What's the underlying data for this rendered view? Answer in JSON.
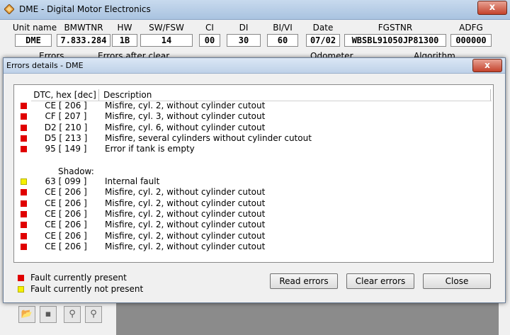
{
  "window": {
    "title": "DME - Digital Motor Electronics",
    "close_label": "x"
  },
  "info": [
    {
      "key": "unit",
      "label": "Unit name",
      "value": "DME"
    },
    {
      "key": "bmwtnr",
      "label": "BMWTNR",
      "value": "7.833.284"
    },
    {
      "key": "hw",
      "label": "HW",
      "value": "1B"
    },
    {
      "key": "swfsw",
      "label": "SW/FSW",
      "value": "14"
    },
    {
      "key": "ci",
      "label": "CI",
      "value": "00"
    },
    {
      "key": "di",
      "label": "DI",
      "value": "30"
    },
    {
      "key": "bivi",
      "label": "BI/VI",
      "value": "60"
    },
    {
      "key": "date",
      "label": "Date",
      "value": "07/02"
    },
    {
      "key": "fgstnr",
      "label": "FGSTNR",
      "value": "WBSBL91050JP81300"
    },
    {
      "key": "adfg",
      "label": "ADFG",
      "value": "000000"
    }
  ],
  "row2": {
    "errors": "Errors",
    "errors_after_clear": "Errors after clear",
    "odometer": "Odometer",
    "algorithm": "Algorithm"
  },
  "dialog": {
    "title": "Errors details - DME",
    "close_label": "x",
    "header": {
      "dtc": "DTC, hex [dec]",
      "description": "Description"
    },
    "shadow_label": "Shadow:",
    "faults": [
      {
        "status": "red",
        "dtc": "CE [ 206 ]",
        "description": "Misfire, cyl. 2, without cylinder cutout"
      },
      {
        "status": "red",
        "dtc": "CF [ 207 ]",
        "description": "Misfire, cyl. 3, without cylinder cutout"
      },
      {
        "status": "red",
        "dtc": "D2 [ 210 ]",
        "description": "Misfire, cyl. 6, without cylinder cutout"
      },
      {
        "status": "red",
        "dtc": "D5 [ 213 ]",
        "description": "Misfire, several cylinders without cylinder cutout"
      },
      {
        "status": "red",
        "dtc": "95 [ 149 ]",
        "description": "Error if tank is empty"
      }
    ],
    "shadow": [
      {
        "status": "yellow",
        "dtc": "63 [ 099 ]",
        "description": "Internal fault"
      },
      {
        "status": "red",
        "dtc": "CE [ 206 ]",
        "description": "Misfire, cyl. 2, without cylinder cutout"
      },
      {
        "status": "red",
        "dtc": "CE [ 206 ]",
        "description": "Misfire, cyl. 2, without cylinder cutout"
      },
      {
        "status": "red",
        "dtc": "CE [ 206 ]",
        "description": "Misfire, cyl. 2, without cylinder cutout"
      },
      {
        "status": "red",
        "dtc": "CE [ 206 ]",
        "description": "Misfire, cyl. 2, without cylinder cutout"
      },
      {
        "status": "red",
        "dtc": "CE [ 206 ]",
        "description": "Misfire, cyl. 2, without cylinder cutout"
      },
      {
        "status": "red",
        "dtc": "CE [ 206 ]",
        "description": "Misfire, cyl. 2, without cylinder cutout"
      }
    ],
    "legend": {
      "present": "Fault currently present",
      "not_present": "Fault currently not present"
    },
    "buttons": {
      "read": "Read errors",
      "clear": "Clear errors",
      "close": "Close"
    }
  },
  "toolbar": [
    {
      "name": "open-folder-icon",
      "glyph": "📂"
    },
    {
      "name": "save-icon",
      "glyph": "▪"
    },
    {
      "name": "find-icon",
      "glyph": "⚲"
    },
    {
      "name": "find-next-icon",
      "glyph": "⚲"
    }
  ],
  "colors": {
    "fault_present": "#e00000",
    "fault_not_present": "#f5f000"
  }
}
